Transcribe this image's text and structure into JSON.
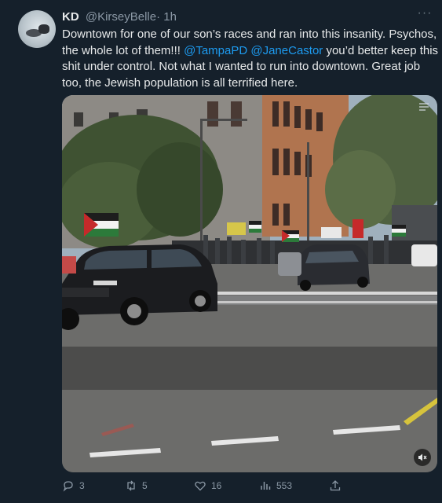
{
  "tweet": {
    "author_name": "KD",
    "author_handle": "@KirseyBelle",
    "timestamp": "· 1h",
    "more_label": "···",
    "text_part1": "Downtown for one of our son’s races and ran into this insanity. Psychos, the whole lot of them!!! ",
    "mention_1": "@TampaPD",
    "text_space": " ",
    "mention_2": "@JaneCastor",
    "text_part2": " you’d better keep this shit under control. Not what I wanted to run into downtown. Great job too, the Jewish population is all terrified here."
  },
  "media": {
    "type": "video",
    "description_icons": [
      "mute-icon",
      "expand-icon"
    ]
  },
  "actions": {
    "reply_count": "3",
    "retweet_count": "5",
    "like_count": "16",
    "view_count": "553"
  },
  "colors": {
    "background": "#15202b",
    "text": "#e7e9ea",
    "secondary": "#8b98a5",
    "link": "#1d9bf0"
  }
}
